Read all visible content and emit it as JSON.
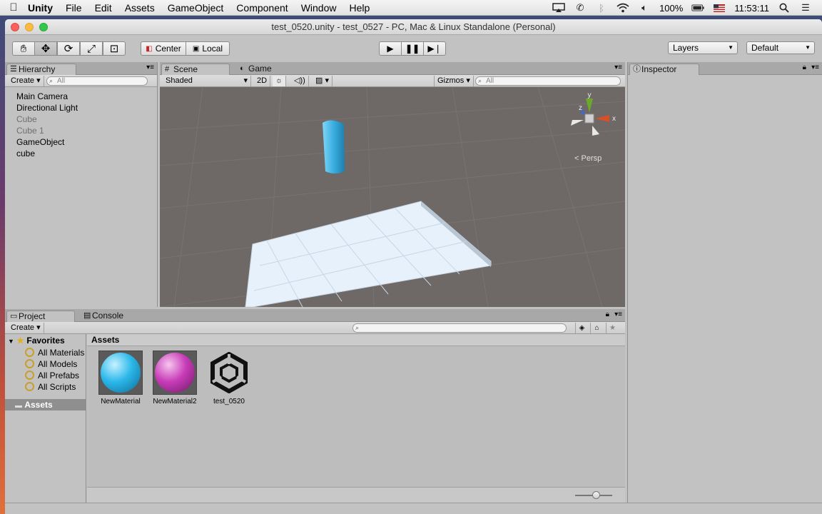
{
  "menubar": {
    "apple": "",
    "app": "Unity",
    "items": [
      "File",
      "Edit",
      "Assets",
      "GameObject",
      "Component",
      "Window",
      "Help"
    ],
    "battery": "100%",
    "time": "11:53:11"
  },
  "window": {
    "title": "test_0520.unity - test_0527 - PC, Mac & Linux Standalone (Personal)"
  },
  "toolbar": {
    "pivot_label": "Center",
    "space_label": "Local",
    "layers_label": "Layers",
    "layout_label": "Default"
  },
  "hierarchy": {
    "tab": "Hierarchy",
    "create": "Create",
    "search_placeholder": "All",
    "items": [
      {
        "label": "Main Camera",
        "dim": false
      },
      {
        "label": "Directional Light",
        "dim": false
      },
      {
        "label": "Cube",
        "dim": true
      },
      {
        "label": "Cube 1",
        "dim": true
      },
      {
        "label": "GameObject",
        "dim": false
      },
      {
        "label": "cube",
        "dim": false
      }
    ]
  },
  "scene": {
    "tab_scene": "Scene",
    "tab_game": "Game",
    "shading": "Shaded",
    "mode_2d": "2D",
    "gizmos": "Gizmos",
    "search_placeholder": "All",
    "persp": "Persp",
    "axis_x": "x",
    "axis_y": "y",
    "axis_z": "z"
  },
  "inspector": {
    "tab": "Inspector"
  },
  "project": {
    "tab_project": "Project",
    "tab_console": "Console",
    "create": "Create",
    "favorites_label": "Favorites",
    "favorites": [
      "All Materials",
      "All Models",
      "All Prefabs",
      "All Scripts"
    ],
    "assets_folder": "Assets",
    "breadcrumb": "Assets",
    "assets": [
      {
        "name": "NewMaterial",
        "kind": "material",
        "color": "#2bb8ea"
      },
      {
        "name": "NewMaterial2",
        "kind": "material",
        "color": "#c83cb8"
      },
      {
        "name": "test_0520",
        "kind": "unity-scene",
        "color": "#111111"
      }
    ]
  },
  "colors": {
    "selection": "#8f8f8f",
    "scene_bg": "#6e6866",
    "cube": "#3aaee0",
    "plane": "#e6f1fb"
  }
}
